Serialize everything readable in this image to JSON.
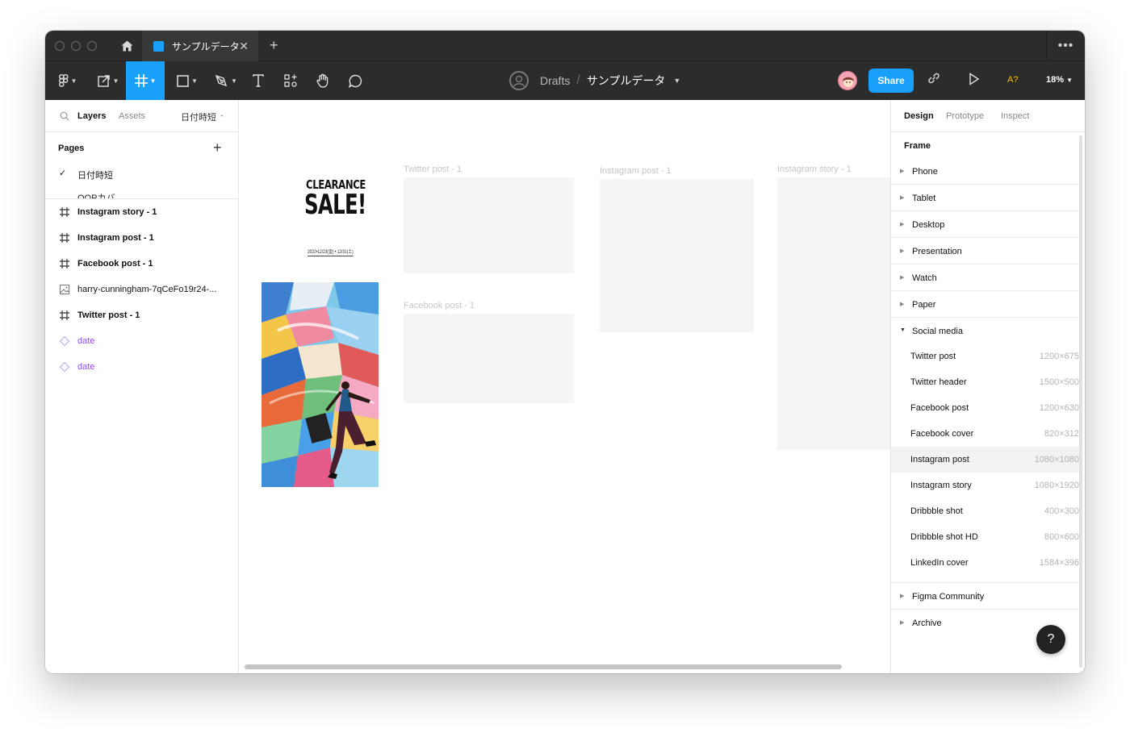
{
  "tab": {
    "title": "サンプルデータ"
  },
  "toolbar": {
    "breadcrumb_drafts": "Drafts",
    "breadcrumb_sep": "/",
    "breadcrumb_file": "サンプルデータ",
    "share_label": "Share",
    "a11y_label": "A?",
    "zoom_label": "18%",
    "icons": [
      "figma-menu-icon",
      "move-icon",
      "frame-icon",
      "shape-icon",
      "pen-icon",
      "text-icon",
      "resources-icon",
      "hand-icon",
      "comment-icon",
      "link-icon",
      "present-icon"
    ]
  },
  "leftpanel": {
    "tab_layers": "Layers",
    "tab_assets": "Assets",
    "page_select": "日付時短",
    "pages_title": "Pages",
    "pages": [
      {
        "label": "日付時短",
        "checked": true
      },
      {
        "label": "OOPカバ",
        "checked": false
      }
    ],
    "layers": [
      {
        "label": "Instagram story - 1",
        "type": "frame"
      },
      {
        "label": "Instagram post - 1",
        "type": "frame"
      },
      {
        "label": "Facebook post - 1",
        "type": "frame"
      },
      {
        "label": "harry-cunningham-7qCeFo19r24-...",
        "type": "image"
      },
      {
        "label": "Twitter post - 1",
        "type": "frame"
      },
      {
        "label": "date",
        "type": "component"
      },
      {
        "label": "date",
        "type": "component"
      }
    ]
  },
  "canvas": {
    "clearance": "CLEARANCE",
    "sale": "SALE!",
    "dates": "2022•12/23(金) • 12/31(土)",
    "frames": [
      {
        "label": "Twitter post - 1"
      },
      {
        "label": "Facebook post - 1"
      },
      {
        "label": "Instagram post - 1"
      },
      {
        "label": "Instagram story - 1"
      }
    ]
  },
  "rightpanel": {
    "tab_design": "Design",
    "tab_prototype": "Prototype",
    "tab_inspect": "Inspect",
    "section_title": "Frame",
    "categories_top": [
      "Phone",
      "Tablet",
      "Desktop",
      "Presentation",
      "Watch",
      "Paper"
    ],
    "open_category": "Social media",
    "presets": [
      {
        "label": "Twitter post",
        "size": "1200×675"
      },
      {
        "label": "Twitter header",
        "size": "1500×500"
      },
      {
        "label": "Facebook post",
        "size": "1200×630"
      },
      {
        "label": "Facebook cover",
        "size": "820×312"
      },
      {
        "label": "Instagram post",
        "size": "1080×1080"
      },
      {
        "label": "Instagram story",
        "size": "1080×1920"
      },
      {
        "label": "Dribbble shot",
        "size": "400×300"
      },
      {
        "label": "Dribbble shot HD",
        "size": "800×600"
      },
      {
        "label": "LinkedIn cover",
        "size": "1584×396"
      }
    ],
    "categories_bottom": [
      "Figma Community",
      "Archive"
    ],
    "help_label": "?"
  },
  "colors": {
    "accent": "#18a0fb",
    "toolbar_bg": "#2c2c2c",
    "component": "#9747ff",
    "frame_fill": "#f7f5f3"
  }
}
